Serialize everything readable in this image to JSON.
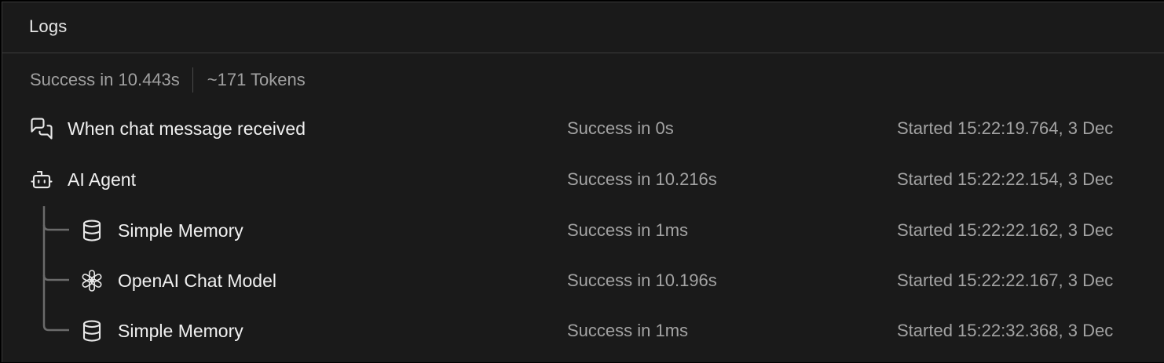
{
  "header": {
    "title": "Logs"
  },
  "summary": {
    "status": "Success in 10.443s",
    "tokens": "~171 Tokens"
  },
  "rows": [
    {
      "icon": "chat-bubbles-icon",
      "name": "When chat message received",
      "status": "Success in 0s",
      "started": "Started 15:22:19.764, 3 Dec",
      "depth": 0
    },
    {
      "icon": "robot-icon",
      "name": "AI Agent",
      "status": "Success in 10.216s",
      "started": "Started 15:22:22.154, 3 Dec",
      "depth": 0
    },
    {
      "icon": "database-icon",
      "name": "Simple Memory",
      "status": "Success in 1ms",
      "started": "Started 15:22:22.162, 3 Dec",
      "depth": 1
    },
    {
      "icon": "openai-icon",
      "name": "OpenAI Chat Model",
      "status": "Success in 10.196s",
      "started": "Started 15:22:22.167, 3 Dec",
      "depth": 1
    },
    {
      "icon": "database-icon",
      "name": "Simple Memory",
      "status": "Success in 1ms",
      "started": "Started 15:22:32.368, 3 Dec",
      "depth": 1
    }
  ],
  "colors": {
    "panel_background": "#1a1a1a",
    "primary_text": "#f0f0f0",
    "secondary_text": "#a3a3a3",
    "divider": "#3d3d3d",
    "tree_line": "#6b6b6b"
  }
}
